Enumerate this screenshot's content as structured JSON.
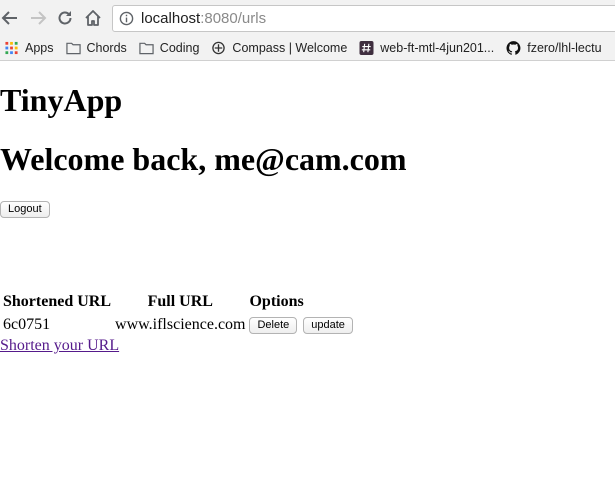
{
  "browser": {
    "url_host": "localhost",
    "url_rest": ":8080/urls",
    "bookmarks": [
      {
        "icon": "apps-grid-icon",
        "label": "Apps"
      },
      {
        "icon": "folder-icon",
        "label": "Chords"
      },
      {
        "icon": "folder-icon",
        "label": "Coding"
      },
      {
        "icon": "compass-icon",
        "label": "Compass | Welcome"
      },
      {
        "icon": "slack-hash-icon",
        "label": "web-ft-mtl-4jun201..."
      },
      {
        "icon": "github-icon",
        "label": "fzero/lhl-lectu"
      }
    ]
  },
  "page": {
    "app_title": "TinyApp",
    "welcome": "Welcome back, me@cam.com",
    "logout_label": "Logout",
    "table": {
      "headers": [
        "Shortened URL",
        "Full URL",
        "Options"
      ],
      "rows": [
        {
          "short": "6c0751",
          "full": "www.iflscience.com",
          "delete_label": "Delete",
          "update_label": "update"
        }
      ]
    },
    "shorten_link": "Shorten your URL"
  },
  "colors": {
    "link_visited": "#551a8b",
    "url_gray": "#8a8a8a"
  }
}
